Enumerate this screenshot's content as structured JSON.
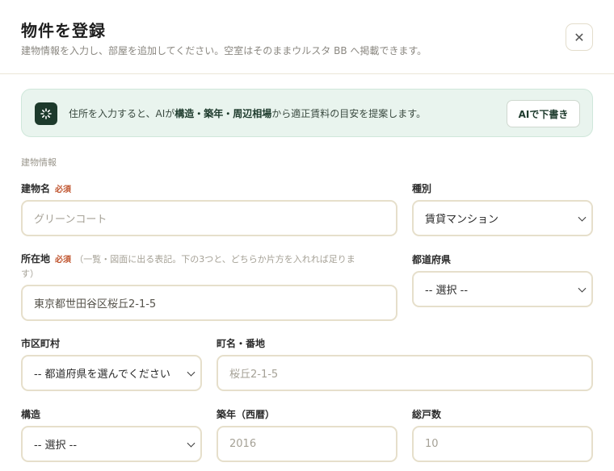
{
  "header": {
    "title": "物件を登録",
    "subtitle": "建物情報を入力し、部屋を追加してください。空室はそのままウルスタ BB へ掲載できます。",
    "close_symbol": "✕"
  },
  "ai_banner": {
    "icon": "sparkle-icon",
    "text_prefix": "住所を入力すると、AIが",
    "text_bold": "構造・築年・周辺相場",
    "text_suffix": "から適正賃料の目安を提案します。",
    "button_label": "AIで下書き"
  },
  "section": {
    "label": "建物情報"
  },
  "form": {
    "required_mark": "必須",
    "building_name": {
      "label": "建物名",
      "placeholder": "グリーンコート"
    },
    "type": {
      "label": "種別",
      "value": "賃貸マンション"
    },
    "address": {
      "label": "所在地",
      "hint_line1": "（一覧・図面に出る表記。下の3つと、どちらか片方を入れれば足りま",
      "hint_line2": "す）",
      "placeholder": "東京都世田谷区桜丘2-1-5"
    },
    "prefecture": {
      "label": "都道府県",
      "value": "-- 選択 --"
    },
    "city": {
      "label": "市区町村",
      "value": "-- 都道府県を選んでください"
    },
    "street": {
      "label": "町名・番地",
      "placeholder": "桜丘2-1-5"
    },
    "structure": {
      "label": "構造",
      "value": "-- 選択 --"
    },
    "built_year": {
      "label": "築年（西暦）",
      "placeholder": "2016"
    },
    "units": {
      "label": "総戸数",
      "placeholder": "10"
    }
  },
  "colors": {
    "accent_dark": "#1d3a2c",
    "banner_bg": "#e9f4ee",
    "required": "#c0552f",
    "field_border": "#e6dfcb"
  }
}
